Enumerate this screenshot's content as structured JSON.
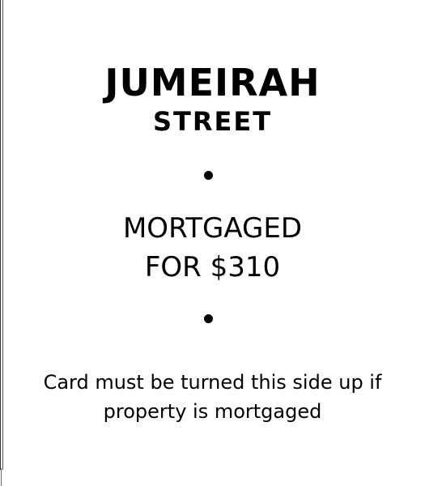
{
  "card": {
    "title": "JUMEIRAH",
    "subtitle": "STREET",
    "status_line1": "MORTGAGED",
    "status_line2": "FOR $310",
    "note": "Card must be turned this side up if property is mortgaged"
  }
}
